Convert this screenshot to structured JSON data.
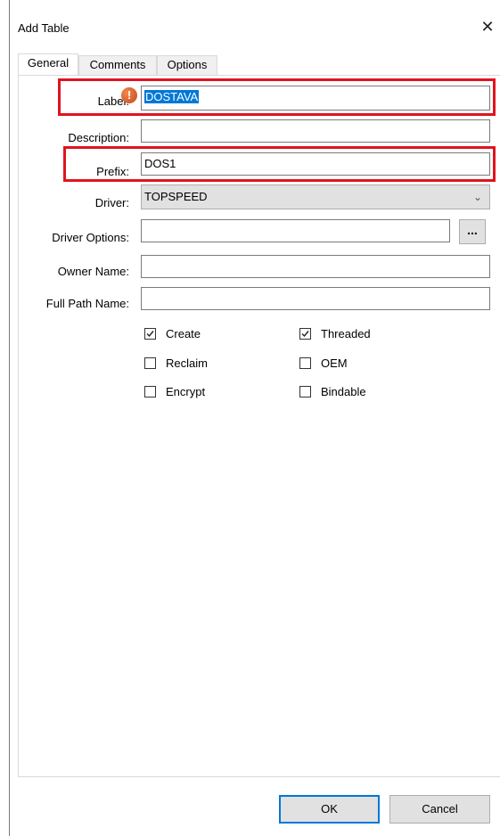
{
  "window": {
    "title": "Add Table",
    "close_icon": "close-icon"
  },
  "tabs": [
    {
      "label": "General",
      "active": true
    },
    {
      "label": "Comments",
      "active": false
    },
    {
      "label": "Options",
      "active": false
    }
  ],
  "form": {
    "label": {
      "caption": "Label:",
      "value": "DOSTAVA"
    },
    "description": {
      "caption": "Description:",
      "value": ""
    },
    "prefix": {
      "caption": "Prefix:",
      "value": "DOS1"
    },
    "driver": {
      "caption": "Driver:",
      "value": "TOPSPEED"
    },
    "driver_options": {
      "caption": "Driver Options:",
      "value": "",
      "button_label": "..."
    },
    "owner_name": {
      "caption": "Owner Name:",
      "value": ""
    },
    "full_path_name": {
      "caption": "Full Path Name:",
      "value": ""
    }
  },
  "checkboxes": [
    {
      "label": "Create",
      "checked": true
    },
    {
      "label": "Threaded",
      "checked": true
    },
    {
      "label": "Reclaim",
      "checked": false
    },
    {
      "label": "OEM",
      "checked": false
    },
    {
      "label": "Encrypt",
      "checked": false
    },
    {
      "label": "Bindable",
      "checked": false
    }
  ],
  "buttons": {
    "ok": "OK",
    "cancel": "Cancel"
  },
  "colors": {
    "highlight": "#e0141e",
    "selection": "#0078d7",
    "warning": "#d9541f"
  }
}
